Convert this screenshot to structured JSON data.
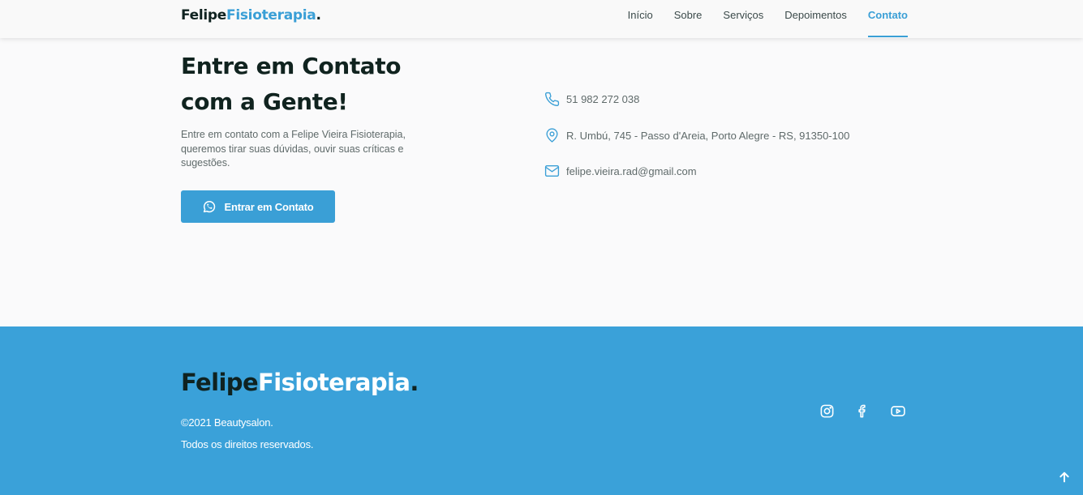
{
  "header": {
    "logo_first": "Felipe",
    "logo_accent": "Fisioterapia",
    "logo_dot": ".",
    "nav": [
      {
        "label": "Início"
      },
      {
        "label": "Sobre"
      },
      {
        "label": "Serviços"
      },
      {
        "label": "Depoimentos"
      },
      {
        "label": "Contato",
        "active": true
      }
    ]
  },
  "contact": {
    "title": "Entre em Contato com a Gente!",
    "description": "Entre em contato com a Felipe Vieira Fisioterapia, queremos tirar suas dúvidas, ouvir suas críticas e sugestões.",
    "cta_label": "Entrar em Contato",
    "cta_icon": "whatsapp-icon",
    "info": [
      {
        "icon": "phone-icon",
        "text": "51 982 272 038"
      },
      {
        "icon": "map-pin-icon",
        "text": "R. Umbú, 745 - Passo d'Areia, Porto Alegre - RS, 91350-100"
      },
      {
        "icon": "mail-icon",
        "text": "felipe.vieira.rad@gmail.com"
      }
    ]
  },
  "footer": {
    "logo_first": "Felipe",
    "logo_accent": "Fisioterapia",
    "logo_dot": ".",
    "copyright": "©2021 Beautysalon.",
    "rights": "Todos os direitos reservados.",
    "social": [
      "instagram-icon",
      "facebook-icon",
      "youtube-icon"
    ]
  },
  "colors": {
    "accent": "#3a9fd6",
    "footer_bg": "#3aa1d9",
    "dark_text": "#10231f"
  }
}
